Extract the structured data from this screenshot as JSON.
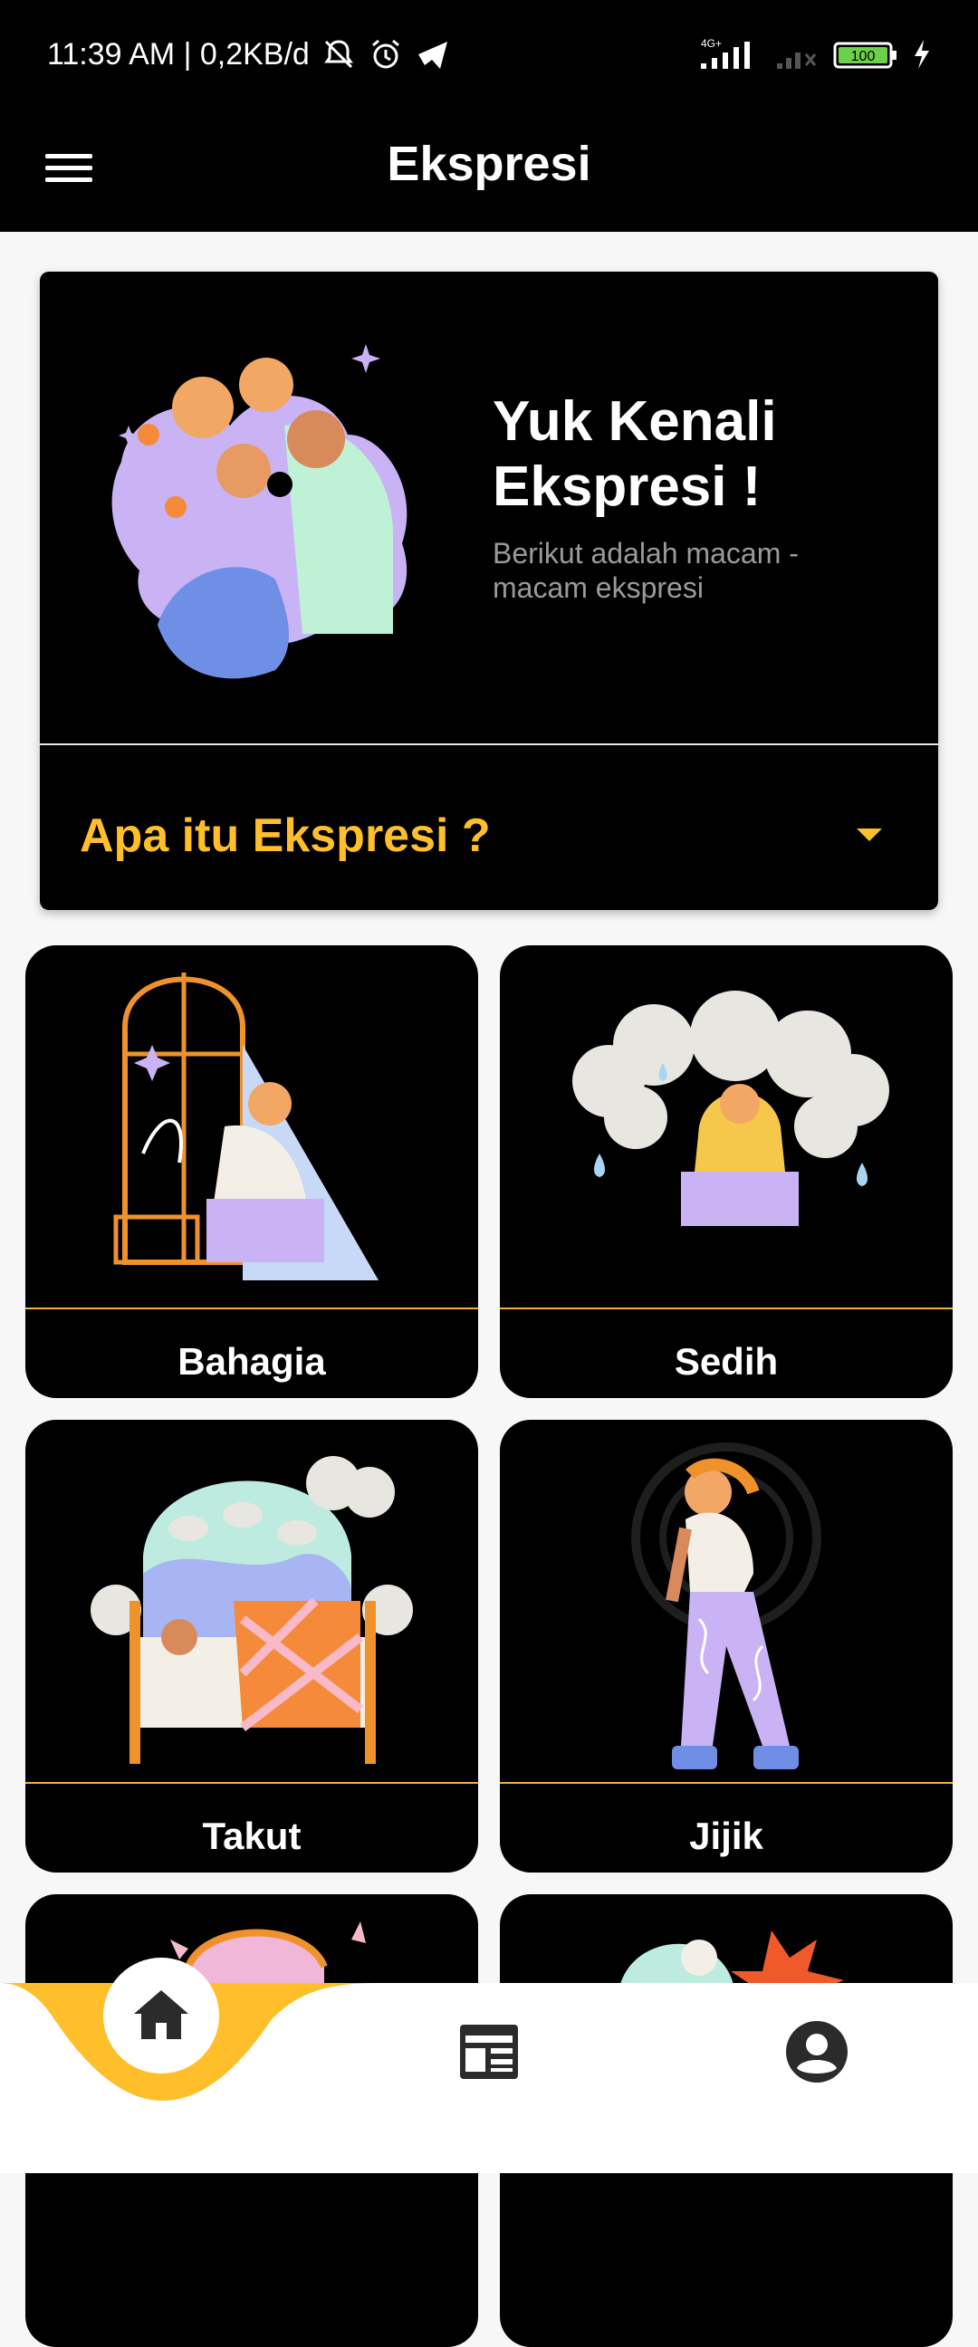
{
  "status_bar": {
    "time_speed": "11:39 AM | 0,2KB/d",
    "network_label": "4G+",
    "battery_level": "100",
    "icons": [
      "bell-off-icon",
      "alarm-icon",
      "telegram-icon",
      "signal-icon",
      "battery-icon",
      "charging-icon"
    ]
  },
  "app_bar": {
    "title": "Ekspresi",
    "menu_icon": "menu-icon"
  },
  "hero": {
    "title": "Yuk Kenali Ekspresi !",
    "subtitle": "Berikut adalah macam - macam ekspresi",
    "faq_label": "Apa itu Ekspresi ?"
  },
  "cards": [
    {
      "label": "Bahagia"
    },
    {
      "label": "Sedih"
    },
    {
      "label": "Takut"
    },
    {
      "label": "Jijik"
    }
  ],
  "bottom_nav": {
    "items": [
      {
        "icon": "home-icon",
        "active": true
      },
      {
        "icon": "news-icon",
        "active": false
      },
      {
        "icon": "profile-icon",
        "active": false
      }
    ]
  },
  "colors": {
    "accent": "#ffbf2b",
    "card_background": "#000000",
    "page_background": "#f7f7f7"
  }
}
